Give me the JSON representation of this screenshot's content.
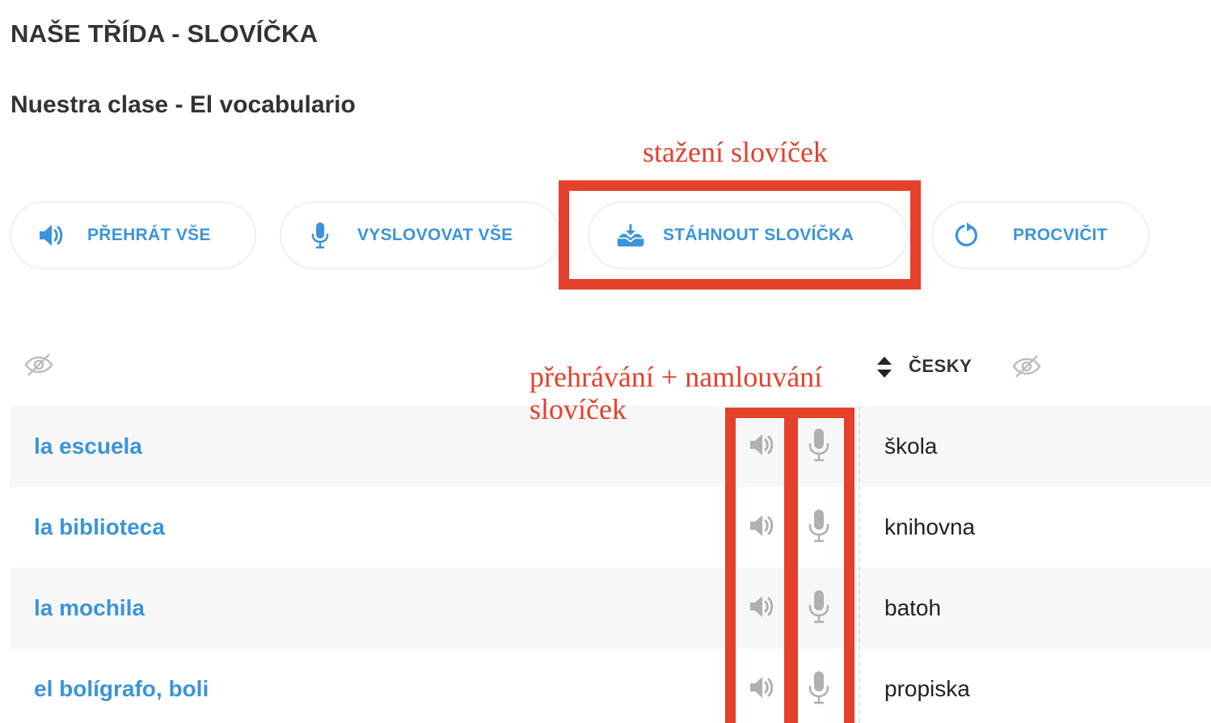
{
  "header": {
    "title": "NAŠE TŘÍDA - SLOVÍČKA",
    "subtitle": "Nuestra clase - El vocabulario"
  },
  "toolbar": {
    "play_all": "PŘEHRÁT VŠE",
    "pronounce_all": "VYSLOVOVAT VŠE",
    "download": "STÁHNOUT SLOVÍČKA",
    "practice": "PROCVIČIT"
  },
  "annotations": {
    "download_note": "stažení slovíček",
    "audio_note_line1": "přehrávání + namlouvání",
    "audio_note_line2": "slovíček",
    "color": "#e5402a"
  },
  "table": {
    "target_column_header": "ČESKY",
    "rows": [
      {
        "es": "la escuela",
        "cz": "škola"
      },
      {
        "es": "la biblioteca",
        "cz": "knihovna"
      },
      {
        "es": "la mochila",
        "cz": "batoh"
      },
      {
        "es": "el bolígrafo, boli",
        "cz": "propiska"
      }
    ]
  },
  "colors": {
    "accent": "#3b94d9",
    "text_dark": "#333333",
    "icon_gray": "#b0b0b0",
    "row_alt_bg": "#f7f7f7"
  },
  "icons": [
    "speaker-icon",
    "microphone-icon",
    "download-icon",
    "refresh-icon",
    "eye-off-icon",
    "sort-icon"
  ]
}
